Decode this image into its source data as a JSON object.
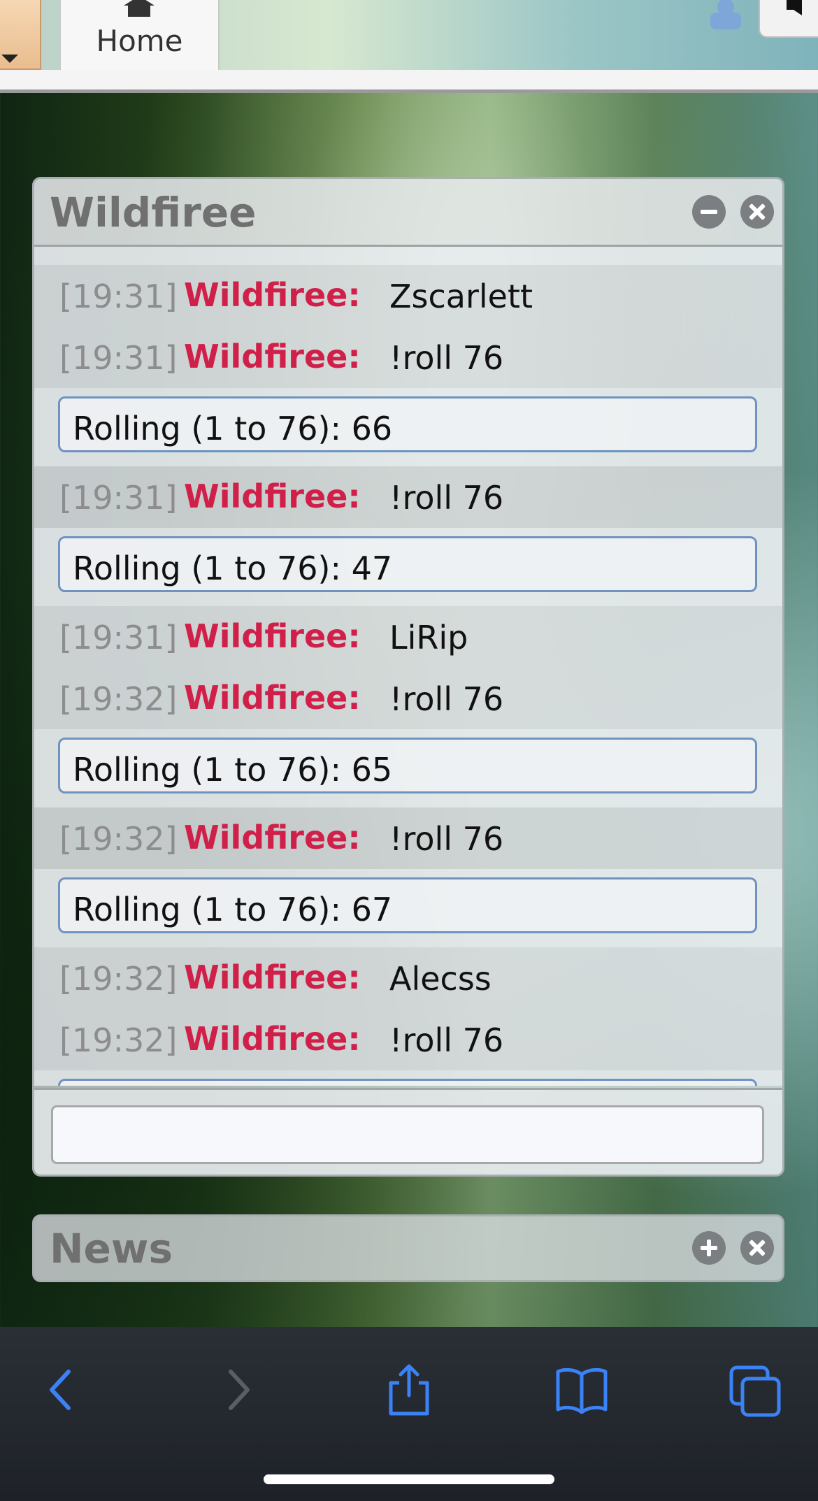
{
  "topbar": {
    "home_label": "Home"
  },
  "chat": {
    "title": "Wildfiree",
    "groups": [
      {
        "messages": [
          {
            "time": "[19:31]",
            "user": "Wildfiree:",
            "text": "Zscarlett"
          },
          {
            "time": "[19:31]",
            "user": "Wildfiree:",
            "text": "!roll 76"
          }
        ],
        "roll": "Rolling (1 to 76): 66"
      },
      {
        "messages": [
          {
            "time": "[19:31]",
            "user": "Wildfiree:",
            "text": "!roll 76"
          }
        ],
        "roll": "Rolling (1 to 76): 47"
      },
      {
        "messages": [
          {
            "time": "[19:31]",
            "user": "Wildfiree:",
            "text": "LiRip"
          },
          {
            "time": "[19:32]",
            "user": "Wildfiree:",
            "text": "!roll 76"
          }
        ],
        "roll": "Rolling (1 to 76): 65"
      },
      {
        "messages": [
          {
            "time": "[19:32]",
            "user": "Wildfiree:",
            "text": "!roll 76"
          }
        ],
        "roll": "Rolling (1 to 76): 67"
      },
      {
        "messages": [
          {
            "time": "[19:32]",
            "user": "Wildfiree:",
            "text": "Alecss"
          },
          {
            "time": "[19:32]",
            "user": "Wildfiree:",
            "text": "!roll 76"
          }
        ],
        "roll": ""
      }
    ],
    "input_value": ""
  },
  "news": {
    "title": "News"
  },
  "colors": {
    "username": "#d0204a",
    "timestamp": "#8d8d8d",
    "roll_border": "#6f93bf",
    "browser_accent": "#3b82f6"
  },
  "icons": {
    "home": "house-icon",
    "user": "person-icon",
    "minimize": "minus-circle-icon",
    "close": "x-circle-icon",
    "expand": "plus-circle-icon",
    "back": "chevron-left-icon",
    "forward": "chevron-right-icon",
    "share": "share-icon",
    "bookmarks": "book-icon",
    "tabs": "tabs-icon"
  }
}
